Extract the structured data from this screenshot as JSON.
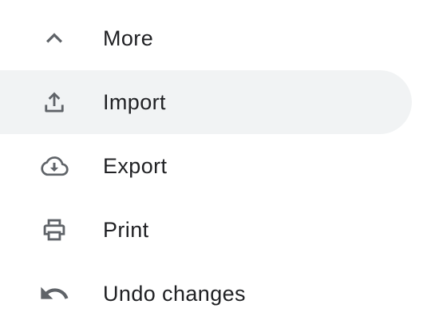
{
  "menu": {
    "items": [
      {
        "label": "More",
        "icon": "chevron-up-icon",
        "active": false
      },
      {
        "label": "Import",
        "icon": "upload-icon",
        "active": true
      },
      {
        "label": "Export",
        "icon": "cloud-download-icon",
        "active": false
      },
      {
        "label": "Print",
        "icon": "print-icon",
        "active": false
      },
      {
        "label": "Undo changes",
        "icon": "undo-icon",
        "active": false
      }
    ]
  },
  "colors": {
    "icon": "#5f6368",
    "text": "#202124",
    "active_background": "#f1f3f4"
  }
}
